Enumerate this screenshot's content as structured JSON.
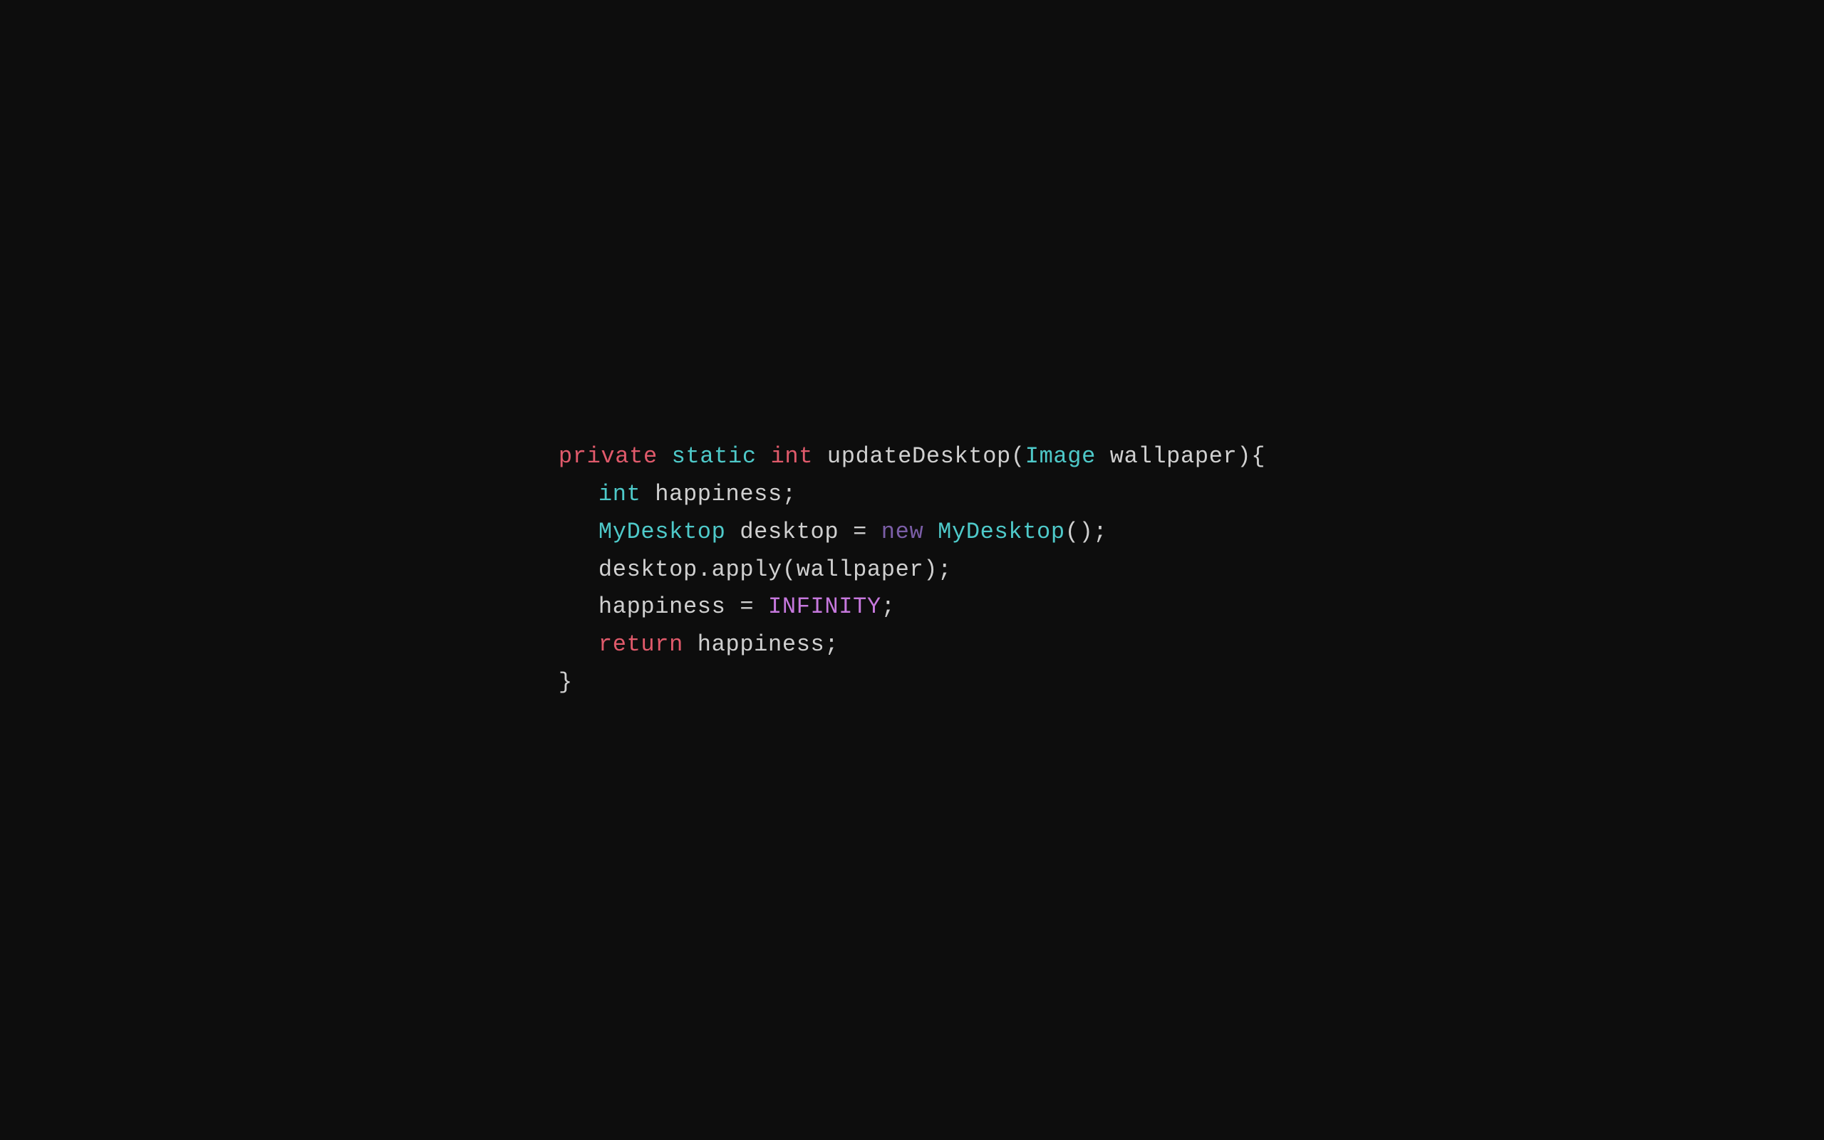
{
  "code": {
    "lines": [
      {
        "id": "line1",
        "parts": [
          {
            "text": "private",
            "cls": "kw-private"
          },
          {
            "text": " ",
            "cls": "plain"
          },
          {
            "text": "static",
            "cls": "kw-static"
          },
          {
            "text": " ",
            "cls": "plain"
          },
          {
            "text": "int",
            "cls": "kw-int"
          },
          {
            "text": " updateDesktop(",
            "cls": "plain"
          },
          {
            "text": "Image",
            "cls": "kw-image"
          },
          {
            "text": " wallpaper){",
            "cls": "plain"
          }
        ],
        "indent": false
      },
      {
        "id": "line2",
        "parts": [
          {
            "text": "int",
            "cls": "kw-int2"
          },
          {
            "text": " happiness;",
            "cls": "plain"
          }
        ],
        "indent": true
      },
      {
        "id": "line3",
        "parts": [
          {
            "text": "MyDesktop",
            "cls": "kw-mydesktop"
          },
          {
            "text": " desktop = ",
            "cls": "plain"
          },
          {
            "text": "new",
            "cls": "kw-new"
          },
          {
            "text": " ",
            "cls": "plain"
          },
          {
            "text": "MyDesktop",
            "cls": "kw-mydesktop2"
          },
          {
            "text": "();",
            "cls": "plain"
          }
        ],
        "indent": true
      },
      {
        "id": "line4",
        "parts": [
          {
            "text": "desktop.apply(wallpaper);",
            "cls": "plain"
          }
        ],
        "indent": true
      },
      {
        "id": "line5",
        "parts": [
          {
            "text": "happiness = ",
            "cls": "plain"
          },
          {
            "text": "INFINITY",
            "cls": "kw-infinity"
          },
          {
            "text": ";",
            "cls": "plain"
          }
        ],
        "indent": true
      },
      {
        "id": "line6",
        "parts": [
          {
            "text": "return",
            "cls": "kw-return"
          },
          {
            "text": " happiness;",
            "cls": "plain"
          }
        ],
        "indent": true
      },
      {
        "id": "line7",
        "parts": [
          {
            "text": "}",
            "cls": "brace"
          }
        ],
        "indent": false
      }
    ]
  }
}
